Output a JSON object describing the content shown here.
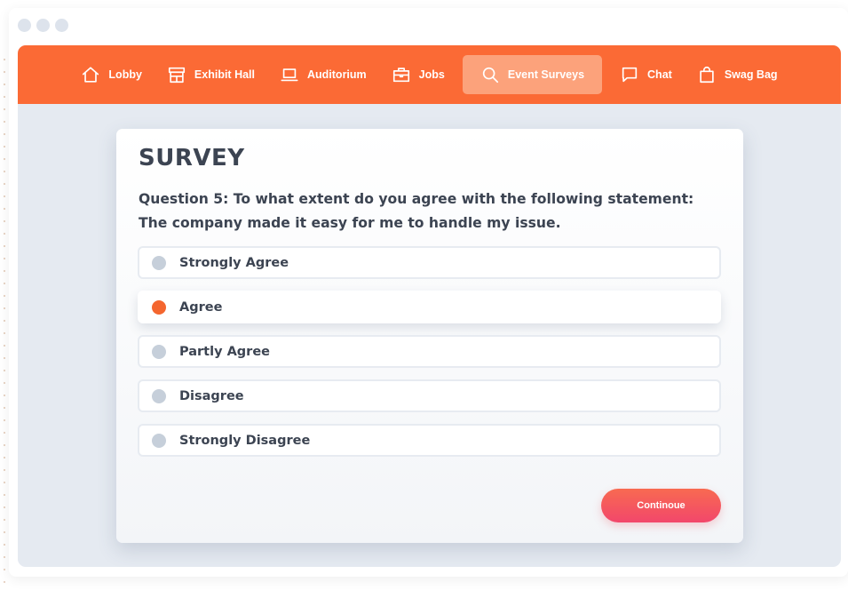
{
  "nav": {
    "items": [
      {
        "label": "Lobby",
        "icon": "home-icon"
      },
      {
        "label": "Exhibit Hall",
        "icon": "storefront-icon"
      },
      {
        "label": "Auditorium",
        "icon": "laptop-icon"
      },
      {
        "label": "Jobs",
        "icon": "briefcase-icon"
      },
      {
        "label": "Event Surveys",
        "icon": "search-icon",
        "active": true
      },
      {
        "label": "Chat",
        "icon": "chat-bubble-icon"
      },
      {
        "label": "Swag Bag",
        "icon": "shopping-bag-icon"
      }
    ],
    "accent_color": "#fb6a35"
  },
  "survey": {
    "title": "SURVEY",
    "question": "Question 5: To what extent do you agree with the following statement: The company made it easy for me to handle my issue.",
    "options": [
      {
        "label": "Strongly Agree",
        "selected": false
      },
      {
        "label": "Agree",
        "selected": true
      },
      {
        "label": "Partly Agree",
        "selected": false
      },
      {
        "label": "Disagree",
        "selected": false
      },
      {
        "label": "Strongly Disagree",
        "selected": false
      }
    ],
    "continue_label": "Continoue"
  }
}
